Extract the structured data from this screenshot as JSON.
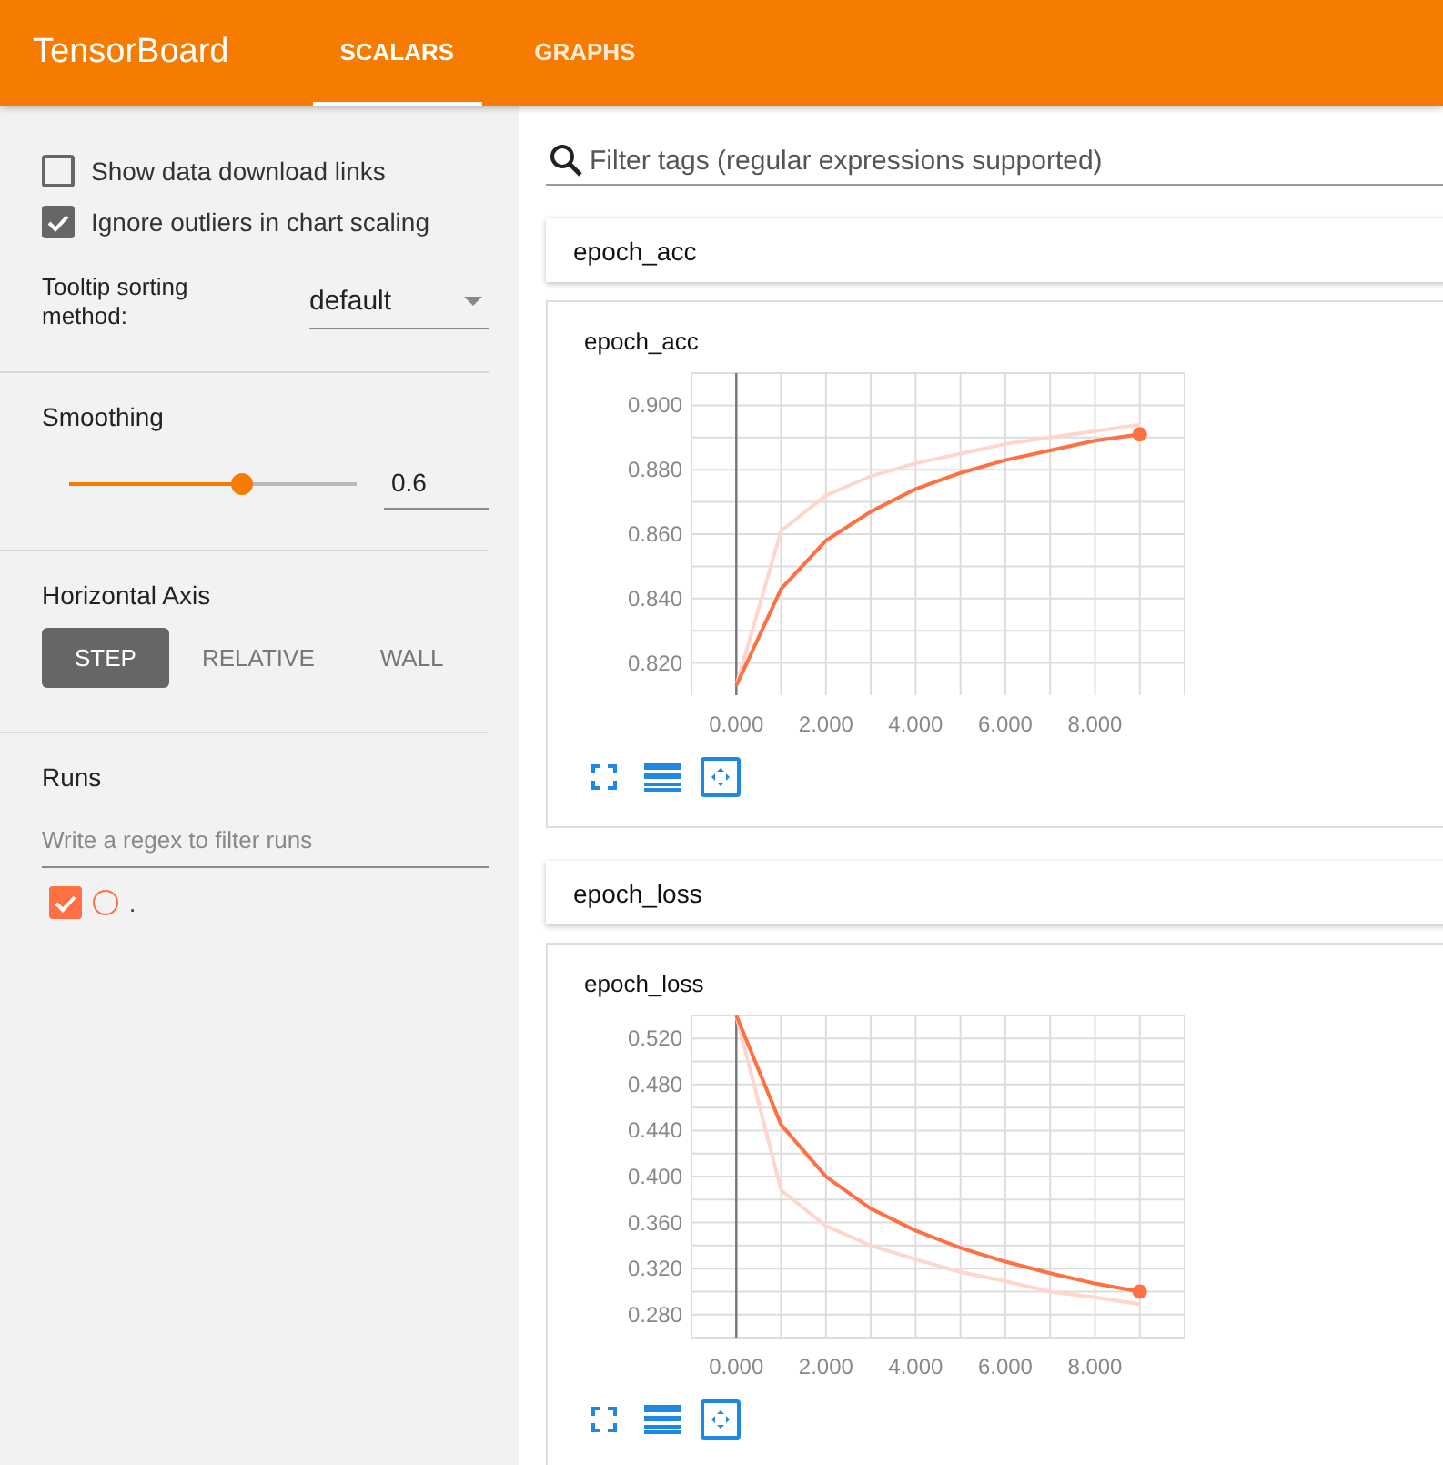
{
  "app": {
    "title": "TensorBoard"
  },
  "tabs": [
    {
      "label": "SCALARS",
      "selected": true
    },
    {
      "label": "GRAPHS",
      "selected": false
    }
  ],
  "sidebar": {
    "options": [
      {
        "label": "Show data download links",
        "checked": false
      },
      {
        "label": "Ignore outliers in chart scaling",
        "checked": true
      }
    ],
    "tooltip_sorting": {
      "label": "Tooltip sorting method:",
      "value": "default"
    },
    "smoothing": {
      "label": "Smoothing",
      "level": 0.6,
      "value": "0.6"
    },
    "horizontal_axis": {
      "label": "Horizontal Axis",
      "options": [
        {
          "label": "STEP",
          "selected": true
        },
        {
          "label": "RELATIVE",
          "selected": false
        },
        {
          "label": "WALL",
          "selected": false
        }
      ]
    },
    "runs": {
      "label": "Runs",
      "placeholder": "Write a regex to filter runs",
      "items": [
        {
          "name": ".",
          "checked": true,
          "color": "#ff7043"
        }
      ]
    }
  },
  "search": {
    "placeholder": "Filter tags (regular expressions supported)"
  },
  "groups": [
    {
      "name": "epoch_acc",
      "title": "epoch_acc",
      "chart_data": {
        "type": "line",
        "x": [
          0,
          1,
          2,
          3,
          4,
          5,
          6,
          7,
          8,
          9
        ],
        "series": [
          {
            "color": "#ff7043",
            "values": [
              0.813,
              0.843,
              0.858,
              0.867,
              0.874,
              0.879,
              0.883,
              0.886,
              0.889,
              0.891
            ]
          },
          {
            "color": "#ffd6cb",
            "values": [
              0.813,
              0.861,
              0.872,
              0.878,
              0.882,
              0.885,
              0.888,
              0.89,
              0.892,
              0.894
            ]
          }
        ],
        "grid": true,
        "xlim": [
          -1,
          10
        ],
        "ylim": [
          0.81,
          0.91
        ],
        "xticks": [
          {
            "value": 0,
            "label": "0.000"
          },
          {
            "value": 2,
            "label": "2.000"
          },
          {
            "value": 4,
            "label": "4.000"
          },
          {
            "value": 6,
            "label": "6.000"
          },
          {
            "value": 8,
            "label": "8.000"
          }
        ],
        "yticks": [
          {
            "value": 0.82,
            "label": "0.820"
          },
          {
            "value": 0.84,
            "label": "0.840"
          },
          {
            "value": 0.86,
            "label": "0.860"
          },
          {
            "value": 0.88,
            "label": "0.880"
          },
          {
            "value": 0.9,
            "label": "0.900"
          }
        ]
      }
    },
    {
      "name": "epoch_loss",
      "title": "epoch_loss",
      "chart_data": {
        "type": "line",
        "x": [
          0,
          1,
          2,
          3,
          4,
          5,
          6,
          7,
          8,
          9
        ],
        "series": [
          {
            "color": "#ff7043",
            "values": [
              0.54,
              0.445,
              0.4,
              0.372,
              0.353,
              0.338,
              0.326,
              0.316,
              0.307,
              0.3
            ]
          },
          {
            "color": "#ffd6cb",
            "values": [
              0.54,
              0.388,
              0.357,
              0.34,
              0.328,
              0.317,
              0.309,
              0.3,
              0.295,
              0.289
            ]
          }
        ],
        "grid": true,
        "xlim": [
          -1,
          10
        ],
        "ylim": [
          0.26,
          0.54
        ],
        "xticks": [
          {
            "value": 0,
            "label": "0.000"
          },
          {
            "value": 2,
            "label": "2.000"
          },
          {
            "value": 4,
            "label": "4.000"
          },
          {
            "value": 6,
            "label": "6.000"
          },
          {
            "value": 8,
            "label": "8.000"
          }
        ],
        "yticks": [
          {
            "value": 0.28,
            "label": "0.280"
          },
          {
            "value": 0.32,
            "label": "0.320"
          },
          {
            "value": 0.36,
            "label": "0.360"
          },
          {
            "value": 0.4,
            "label": "0.400"
          },
          {
            "value": 0.44,
            "label": "0.440"
          },
          {
            "value": 0.48,
            "label": "0.480"
          },
          {
            "value": 0.52,
            "label": "0.520"
          }
        ]
      }
    }
  ]
}
